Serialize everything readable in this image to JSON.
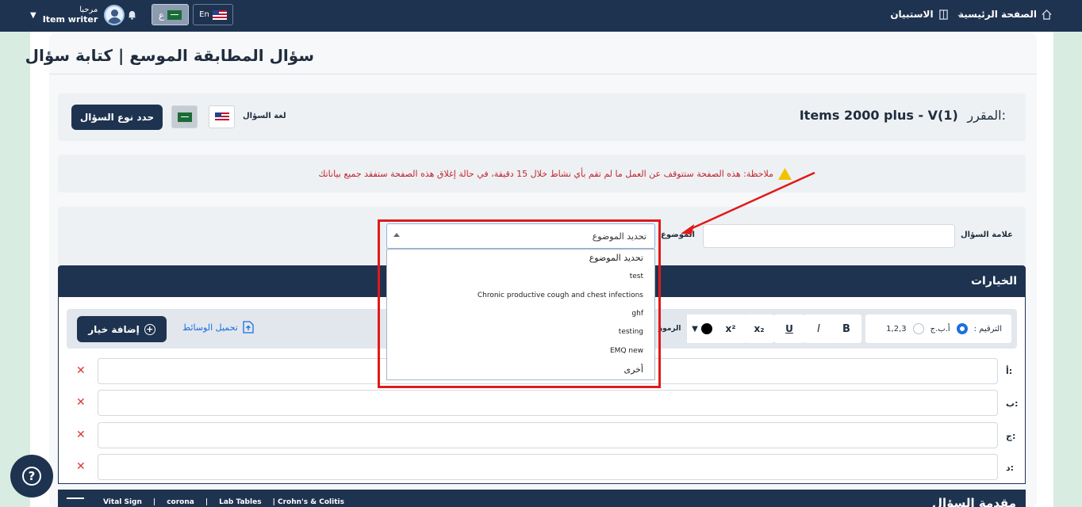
{
  "topbar": {
    "home_label": "الصفحة الرئيسية",
    "survey_label": "الاستبيان",
    "greeting": "مرحبا",
    "role": "Item writer",
    "lang_ar": "ع",
    "lang_en": "En"
  },
  "page": {
    "title": "سؤال المطابقة الموسع | كتابة سؤال"
  },
  "course": {
    "label": "المقرر:",
    "name": "Items 2000 plus - V(1)"
  },
  "question_lang": {
    "label": "لغة السؤال",
    "select_type_button": "حدد نوع السؤال"
  },
  "notice": {
    "text": "ملاحظة: هذه الصفحة ستتوقف عن العمل ما لم تقم بأي نشاط خلال 15 دقيقة، في حالة إغلاق هذه الصفحة ستفقد جميع بياناتك"
  },
  "fields": {
    "question_mark_label": "علامة السؤال",
    "topic_label": "الموضوع"
  },
  "topic_dropdown": {
    "selected": "تحديد الموضوع",
    "options": [
      "تحديد الموضوع",
      "test",
      "Chronic productive cough and chest infections",
      "ghf",
      "testing",
      "EMQ new",
      "أخرى"
    ]
  },
  "options_panel": {
    "title": "الخيارات",
    "numbering_label": "الترقيم :",
    "numbering_alpha": "أ.ب.ج",
    "numbering_numeric": "1,2,3",
    "bold": "B",
    "italic": "I",
    "underline": "U",
    "subscript": "x₂",
    "superscript": "x²",
    "symbols_label": "الرموز",
    "add_option_button": "إضافة خيار",
    "upload_media": "تحميل الوسائط",
    "rows": [
      {
        "letter": "أ:"
      },
      {
        "letter": "ب:"
      },
      {
        "letter": "ج:"
      },
      {
        "letter": "د:"
      }
    ]
  },
  "intro": {
    "title": "مقدمة السؤال",
    "tags": [
      "Vital Sign",
      "|",
      "corona",
      "|",
      "Lab Tables",
      "| Crohn's & Colitis"
    ]
  },
  "colors": {
    "navy": "#1e3350",
    "accent": "#1a6fe0",
    "warning": "#c0262d",
    "highlight": "#e01a1a"
  }
}
